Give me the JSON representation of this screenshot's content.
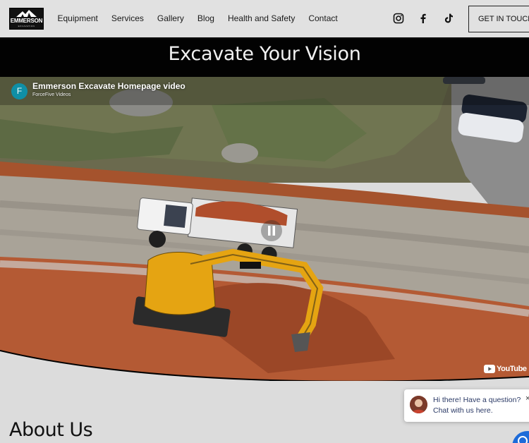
{
  "logo": {
    "text": "EMMERSON",
    "subtext": "EXCAVATION"
  },
  "nav": {
    "items": [
      "Equipment",
      "Services",
      "Gallery",
      "Blog",
      "Health and Safety",
      "Contact"
    ]
  },
  "social": {
    "icons": [
      "instagram-icon",
      "facebook-icon",
      "tiktok-icon"
    ]
  },
  "cta": {
    "label": "GET IN TOUCH"
  },
  "banner": {
    "title": "Excavate Your Vision"
  },
  "video": {
    "avatar_letter": "F",
    "title": "Emmerson Excavate Homepage video",
    "channel": "ForceFive Videos",
    "platform": "YouTube"
  },
  "about": {
    "title": "About Us"
  },
  "chat": {
    "line1": "Hi there! Have a question?",
    "line2": "Chat with us here.",
    "close": "×"
  },
  "colors": {
    "header_bg": "#e1e1e1",
    "banner_bg": "#020202",
    "page_bg": "#dcdcdc",
    "chat_text": "#2b3a66",
    "chat_button": "#1d6bd9",
    "channel_avatar": "#0f8fa6"
  }
}
